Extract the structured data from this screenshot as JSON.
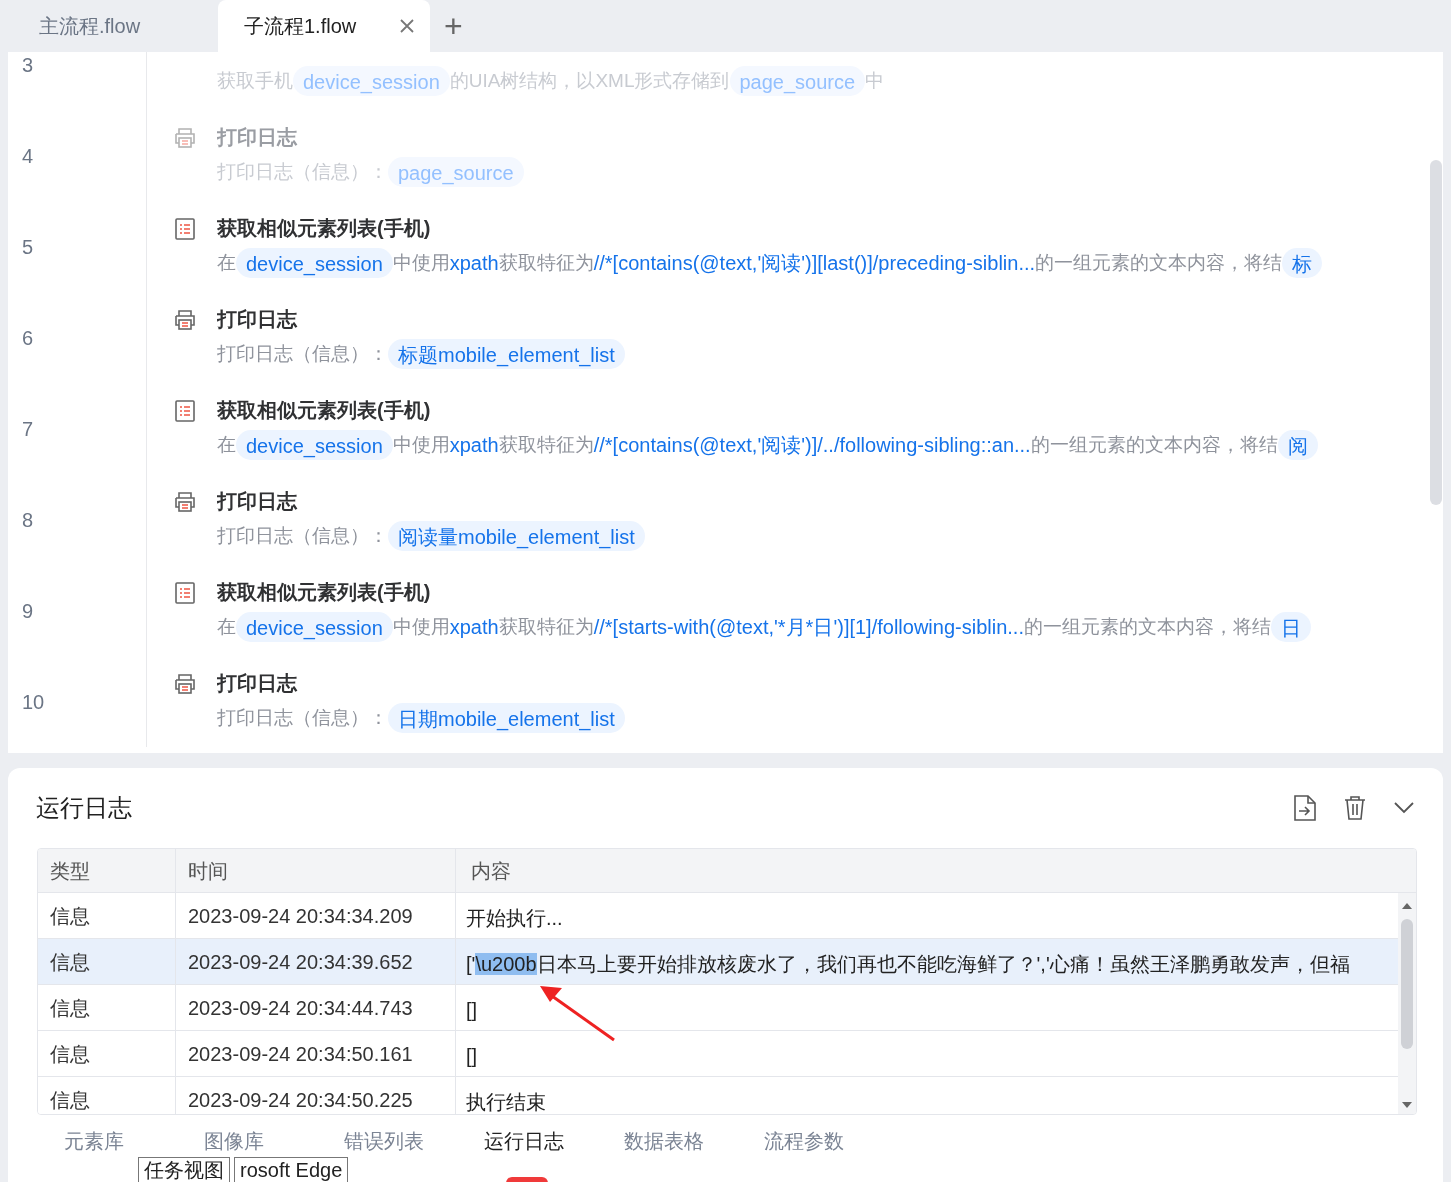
{
  "file_tabs": [
    {
      "label": "主流程.flow",
      "selected": false,
      "closable": false
    },
    {
      "label": "子流程1.flow",
      "selected": true,
      "closable": true
    }
  ],
  "new_tab": "+",
  "steps": [
    {
      "number": "3",
      "kind": "ui_tree",
      "disabled": true,
      "parts": [
        {
          "kind": "text",
          "text": "获取手机"
        },
        {
          "kind": "var",
          "text": "device_session"
        },
        {
          "kind": "text",
          "text": "的UIA树结构，以XML形式存储到"
        },
        {
          "kind": "var",
          "text": "page_source"
        },
        {
          "kind": "text",
          "text": "中"
        }
      ]
    },
    {
      "number": "4",
      "kind": "print",
      "disabled": true,
      "title": "打印日志",
      "parts": [
        {
          "kind": "text",
          "text": "打印日志（信息）："
        },
        {
          "kind": "var",
          "text": "page_source"
        }
      ]
    },
    {
      "number": "5",
      "kind": "element_list",
      "disabled": false,
      "title": "获取相似元素列表(手机)",
      "parts": [
        {
          "kind": "text",
          "text": "在"
        },
        {
          "kind": "var",
          "text": "device_session"
        },
        {
          "kind": "text",
          "text": "中使用"
        },
        {
          "kind": "code",
          "text": "xpath"
        },
        {
          "kind": "text",
          "text": "获取特征为"
        },
        {
          "kind": "code",
          "text": "//*[contains(@text,'阅读')][last()]/preceding-siblin..."
        },
        {
          "kind": "text",
          "text": "的一组元素的文本内容，将结"
        },
        {
          "kind": "var",
          "text": "标"
        }
      ]
    },
    {
      "number": "6",
      "kind": "print",
      "disabled": false,
      "title": "打印日志",
      "parts": [
        {
          "kind": "text",
          "text": "打印日志（信息）："
        },
        {
          "kind": "var",
          "text": "标题mobile_element_list"
        }
      ]
    },
    {
      "number": "7",
      "kind": "element_list",
      "disabled": false,
      "title": "获取相似元素列表(手机)",
      "parts": [
        {
          "kind": "text",
          "text": "在"
        },
        {
          "kind": "var",
          "text": "device_session"
        },
        {
          "kind": "text",
          "text": "中使用"
        },
        {
          "kind": "code",
          "text": "xpath"
        },
        {
          "kind": "text",
          "text": "获取特征为"
        },
        {
          "kind": "code",
          "text": "//*[contains(@text,'阅读')]/../following-sibling::an..."
        },
        {
          "kind": "text",
          "text": "的一组元素的文本内容，将结"
        },
        {
          "kind": "var",
          "text": "阅"
        }
      ]
    },
    {
      "number": "8",
      "kind": "print",
      "disabled": false,
      "title": "打印日志",
      "parts": [
        {
          "kind": "text",
          "text": "打印日志（信息）："
        },
        {
          "kind": "var",
          "text": "阅读量mobile_element_list"
        }
      ]
    },
    {
      "number": "9",
      "kind": "element_list",
      "disabled": false,
      "title": "获取相似元素列表(手机)",
      "parts": [
        {
          "kind": "text",
          "text": "在"
        },
        {
          "kind": "var",
          "text": "device_session"
        },
        {
          "kind": "text",
          "text": "中使用"
        },
        {
          "kind": "code",
          "text": "xpath"
        },
        {
          "kind": "text",
          "text": "获取特征为"
        },
        {
          "kind": "code",
          "text": "//*[starts-with(@text,'*月*日')][1]/following-siblin..."
        },
        {
          "kind": "text",
          "text": "的一组元素的文本内容，将结"
        },
        {
          "kind": "var",
          "text": "日"
        }
      ]
    },
    {
      "number": "10",
      "kind": "print",
      "disabled": false,
      "title": "打印日志",
      "parts": [
        {
          "kind": "text",
          "text": "打印日志（信息）："
        },
        {
          "kind": "var",
          "text": "日期mobile_element_list"
        }
      ]
    }
  ],
  "log_panel": {
    "title": "运行日志",
    "columns": [
      "类型",
      "时间",
      "内容"
    ],
    "rows": [
      {
        "selected": false,
        "type": "信息",
        "time": "2023-09-24 20:34:34.209",
        "content": [
          {
            "text": "开始执行...",
            "highlighted": false
          }
        ]
      },
      {
        "selected": true,
        "type": "信息",
        "time": "2023-09-24 20:34:39.652",
        "content": [
          {
            "text": "['",
            "highlighted": false
          },
          {
            "text": "\\u200b",
            "highlighted": true
          },
          {
            "text": "日本马上要开始排放核废水了，我们再也不能吃海鲜了？','心痛！虽然王泽鹏勇敢发声，但福",
            "highlighted": false
          }
        ]
      },
      {
        "selected": false,
        "type": "信息",
        "time": "2023-09-24 20:34:44.743",
        "content": [
          {
            "text": "[]",
            "highlighted": false
          }
        ]
      },
      {
        "selected": false,
        "type": "信息",
        "time": "2023-09-24 20:34:50.161",
        "content": [
          {
            "text": "[]",
            "highlighted": false
          }
        ]
      },
      {
        "selected": false,
        "type": "信息",
        "time": "2023-09-24 20:34:50.225",
        "content": [
          {
            "text": "执行结束",
            "highlighted": false
          }
        ]
      }
    ]
  },
  "bottom_tabs": [
    {
      "label": "元素库",
      "selected": false
    },
    {
      "label": "图像库",
      "selected": false
    },
    {
      "label": "错误列表",
      "selected": false
    },
    {
      "label": "运行日志",
      "selected": true
    },
    {
      "label": "数据表格",
      "selected": false
    },
    {
      "label": "流程参数",
      "selected": false
    }
  ],
  "tooltips": [
    "任务视图",
    "rosoft Edge"
  ]
}
